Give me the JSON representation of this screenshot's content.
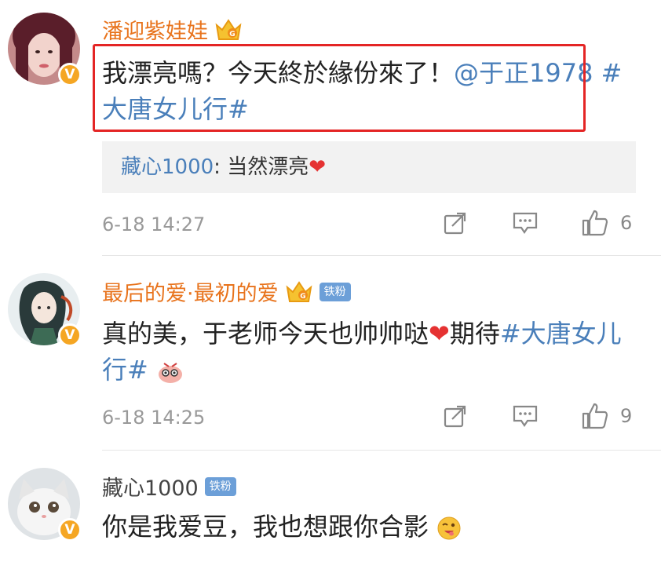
{
  "comments": [
    {
      "username": "潘迎紫娃娃",
      "text_before": "我漂亮嗎？今天終於緣份來了！",
      "mention": "@于正1978",
      "hashtag": "#大唐女儿行#",
      "reply": {
        "user": "藏心1000",
        "sep": ": ",
        "text": "当然漂亮"
      },
      "timestamp": "6-18 14:27",
      "likes": "6"
    },
    {
      "username": "最后的爱·最初的爱",
      "badge": "铁粉",
      "text_before": "真的美，于老师今天也帅帅哒",
      "text_after": "期待",
      "hashtag": "#大唐女儿行#",
      "timestamp": "6-18 14:25",
      "likes": "9"
    },
    {
      "username": "藏心1000",
      "badge": "铁粉",
      "text": "你是我爱豆，我也想跟你合影"
    }
  ],
  "icons": {
    "verify": "v-verified-icon",
    "vip": "crown-icon",
    "share": "share-icon",
    "comment": "comment-icon",
    "like": "thumbs-up-icon"
  },
  "colors": {
    "username": "#e8731c",
    "link": "#4a7fba",
    "highlight": "#e42525",
    "verify": "#f5a623"
  }
}
